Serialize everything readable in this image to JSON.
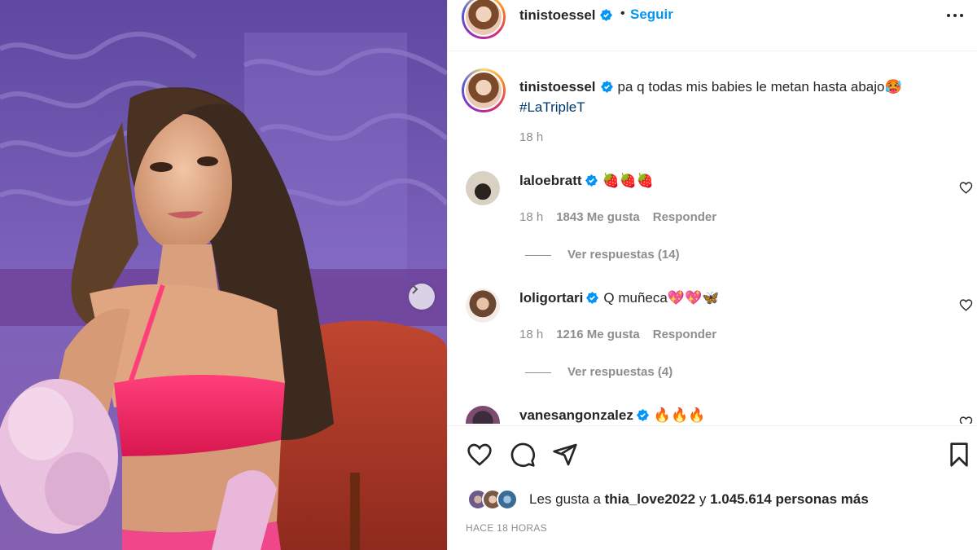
{
  "header": {
    "username": "tinistoessel",
    "separator": "•",
    "follow_label": "Seguir",
    "avatar_icon": "avatar-story-ring",
    "verified_color": "#0095f6"
  },
  "caption": {
    "username": "tinistoessel",
    "text": "pa q todas mis babies le metan hasta abajo🥵",
    "hashtag": "#LaTripleT",
    "time": "18 h"
  },
  "comments": [
    {
      "username": "laloebratt",
      "text": "🍓🍓🍓",
      "time": "18 h",
      "likes": "1843 Me gusta",
      "reply": "Responder",
      "view_replies": "Ver respuestas (14)"
    },
    {
      "username": "loligortari",
      "text": "Q muñeca💖💖🦋",
      "time": "18 h",
      "likes": "1216 Me gusta",
      "reply": "Responder",
      "view_replies": "Ver respuestas (4)"
    },
    {
      "username": "vanesangonzalez",
      "text": "🔥🔥🔥"
    }
  ],
  "likes": {
    "prefix": "Les gusta a ",
    "user": "thia_love2022",
    "middle": " y ",
    "count": "1.045.614 personas más"
  },
  "date": "HACE 18 HORAS",
  "colors": {
    "link_blue": "#0095f6",
    "hashtag": "#00376b",
    "muted": "#8e8e8e",
    "text": "#262626"
  }
}
